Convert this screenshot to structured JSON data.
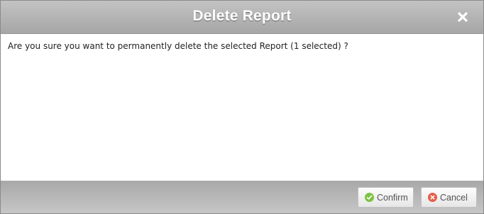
{
  "dialog": {
    "title": "Delete Report",
    "close_icon": "close-icon",
    "message": "Are you sure you want to permanently delete the selected Report (1 selected) ?"
  },
  "footer": {
    "confirm_label": "Confirm",
    "confirm_icon": "check-circle-icon",
    "confirm_icon_color": "#7dc242",
    "cancel_label": "Cancel",
    "cancel_icon": "x-circle-icon",
    "cancel_icon_color": "#e85d4a"
  }
}
